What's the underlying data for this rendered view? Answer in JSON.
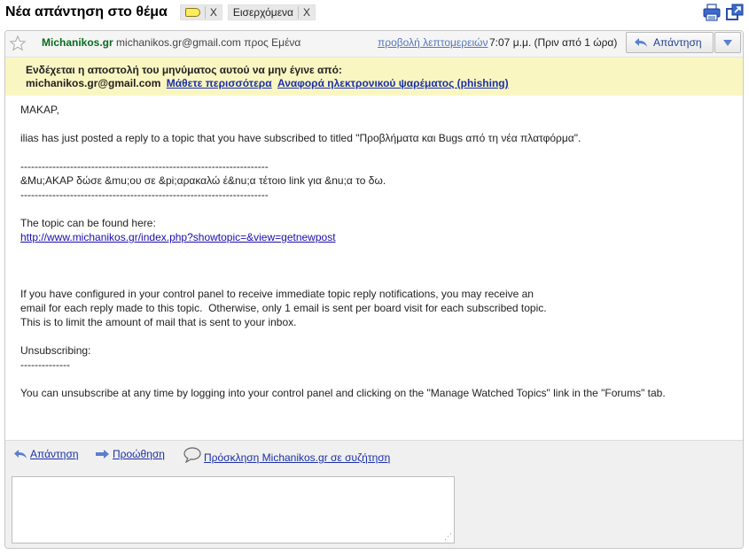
{
  "subject": "Νέα απάντηση στο θέμα",
  "labels": [
    {
      "name": "",
      "remove": "X",
      "type": "tag"
    },
    {
      "name": "Εισερχόμενα",
      "remove": "X",
      "type": "text"
    }
  ],
  "top_icons": [
    "print-icon",
    "new-window-icon"
  ],
  "message": {
    "sender_name": "Michanikos.gr",
    "sender_email": "michanikos.gr@gmail.com",
    "to": "προς Εμένα",
    "details_link": "προβολή λεπτομερειών",
    "time": "7:07 μ.μ. (Πριν από 1 ώρα)",
    "reply_button": "Απάντηση"
  },
  "warning": {
    "line1": "Ενδέχεται η αποστολή του μηνύματος αυτού να μην έγινε από:",
    "email": "michanikos.gr@gmail.com",
    "learn_more": "Μάθετε περισσότερα",
    "report": "Αναφορά ηλεκτρονικού ψαρέματος (phishing)"
  },
  "body": {
    "greeting": "MAKAP,",
    "intro": "ilias has just posted a reply to a topic that you have subscribed to titled \"Προβλήματα και Bugs από τη νέα πλατφόρμα\".",
    "separator_top": "----------------------------------------------------------------------",
    "quote": "&Mu;AKAP δώσε &mu;ου σε &pi;αρακαλώ έ&nu;α τέτοιο link για &nu;α το δω.",
    "separator_bottom": "----------------------------------------------------------------------",
    "topic_found": "The topic can be found here:",
    "topic_link": "http://www.michanikos.gr/index.php?showtopic=&view=getnewpost",
    "info_line1": "If you have configured in your control panel to receive immediate topic reply notifications, you may receive an",
    "info_line2": "email for each reply made to this topic.  Otherwise, only 1 email is sent per board visit for each subscribed topic.",
    "info_line3": "This is to limit the amount of mail that is sent to your inbox.",
    "unsub_title": "Unsubscribing:",
    "unsub_separator": "--------------",
    "unsub_text": "You can unsubscribe at any time by logging into your control panel and clicking on the \"Manage Watched Topics\" link in the \"Forums\" tab."
  },
  "footer": {
    "reply": "Απάντηση",
    "forward": "Προώθηση",
    "invite": "Πρόσκληση Michanikos.gr σε συζήτηση",
    "reply_box_value": ""
  }
}
